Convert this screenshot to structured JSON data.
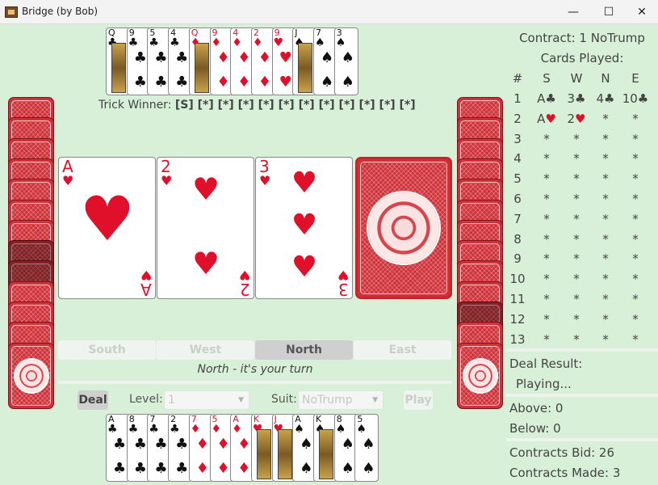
{
  "window": {
    "title": "Bridge (by Bob)",
    "minimize": "—",
    "maximize": "☐",
    "close": "✕"
  },
  "north_hand": [
    {
      "rank": "Q",
      "suit": "♣",
      "color": "black",
      "face": true
    },
    {
      "rank": "9",
      "suit": "♣",
      "color": "black"
    },
    {
      "rank": "5",
      "suit": "♣",
      "color": "black"
    },
    {
      "rank": "4",
      "suit": "♣",
      "color": "black"
    },
    {
      "rank": "Q",
      "suit": "♦",
      "color": "red",
      "face": true
    },
    {
      "rank": "9",
      "suit": "♦",
      "color": "red"
    },
    {
      "rank": "4",
      "suit": "♦",
      "color": "red"
    },
    {
      "rank": "2",
      "suit": "♦",
      "color": "red"
    },
    {
      "rank": "9",
      "suit": "♥",
      "color": "red"
    },
    {
      "rank": "J",
      "suit": "♠",
      "color": "black",
      "face": true
    },
    {
      "rank": "7",
      "suit": "♠",
      "color": "black"
    },
    {
      "rank": "3",
      "suit": "♠",
      "color": "black"
    }
  ],
  "trick_winner": {
    "label": "Trick Winner:",
    "values": "[S] [*] [*] [*] [*] [*] [*] [*] [*] [*] [*] [*]"
  },
  "played_cards": [
    {
      "rank": "A",
      "suit": "♥",
      "player": "South"
    },
    {
      "rank": "2",
      "suit": "♥",
      "player": "West"
    },
    {
      "rank": "3",
      "suit": "♥",
      "player": "North"
    }
  ],
  "players": [
    "South",
    "West",
    "North",
    "East"
  ],
  "active_player": "North",
  "turn_text": "North - it's your turn",
  "controls": {
    "deal": "Deal",
    "level_label": "Level:",
    "level_value": "1",
    "suit_label": "Suit:",
    "suit_value": "NoTrump",
    "play": "Play"
  },
  "south_hand": [
    {
      "rank": "A",
      "suit": "♣",
      "color": "black"
    },
    {
      "rank": "8",
      "suit": "♣",
      "color": "black"
    },
    {
      "rank": "7",
      "suit": "♣",
      "color": "black"
    },
    {
      "rank": "2",
      "suit": "♣",
      "color": "black"
    },
    {
      "rank": "7",
      "suit": "♦",
      "color": "red"
    },
    {
      "rank": "5",
      "suit": "♦",
      "color": "red"
    },
    {
      "rank": "A",
      "suit": "♦",
      "color": "red"
    },
    {
      "rank": "K",
      "suit": "♥",
      "color": "red",
      "face": true
    },
    {
      "rank": "J",
      "suit": "♥",
      "color": "red",
      "face": true
    },
    {
      "rank": "A",
      "suit": "♠",
      "color": "black"
    },
    {
      "rank": "K",
      "suit": "♠",
      "color": "black",
      "face": true
    },
    {
      "rank": "8",
      "suit": "♠",
      "color": "black"
    },
    {
      "rank": "5",
      "suit": "♠",
      "color": "black"
    }
  ],
  "right_panel": {
    "contract": "Contract: 1 NoTrump",
    "cards_played_title": "Cards Played:",
    "headers": [
      "#",
      "S",
      "W",
      "N",
      "E"
    ],
    "rows": [
      [
        "1",
        "A♣",
        "3♣",
        "4♣",
        "10♣"
      ],
      [
        "2",
        "A♥",
        "2♥",
        "*",
        "*"
      ],
      [
        "3",
        "*",
        "*",
        "*",
        "*"
      ],
      [
        "4",
        "*",
        "*",
        "*",
        "*"
      ],
      [
        "5",
        "*",
        "*",
        "*",
        "*"
      ],
      [
        "6",
        "*",
        "*",
        "*",
        "*"
      ],
      [
        "7",
        "*",
        "*",
        "*",
        "*"
      ],
      [
        "8",
        "*",
        "*",
        "*",
        "*"
      ],
      [
        "9",
        "*",
        "*",
        "*",
        "*"
      ],
      [
        "10",
        "*",
        "*",
        "*",
        "*"
      ],
      [
        "11",
        "*",
        "*",
        "*",
        "*"
      ],
      [
        "12",
        "*",
        "*",
        "*",
        "*"
      ],
      [
        "13",
        "*",
        "*",
        "*",
        "*"
      ]
    ],
    "deal_result_label": "Deal Result:",
    "deal_result_value": "Playing...",
    "above": "Above: 0",
    "below": "Below: 0",
    "contracts_bid": "Contracts Bid: 26",
    "contracts_made": "Contracts Made: 3"
  },
  "colors": {
    "background": "#d8efd8",
    "card_back": "#cf3138",
    "red_suit": "#e0102a"
  }
}
